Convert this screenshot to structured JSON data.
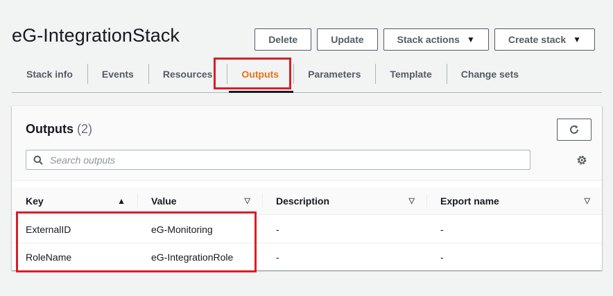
{
  "stack": {
    "name": "eG-IntegrationStack"
  },
  "actions": {
    "delete_label": "Delete",
    "update_label": "Update",
    "stack_actions_label": "Stack actions",
    "create_stack_label": "Create stack"
  },
  "tabs": [
    {
      "label": "Stack info"
    },
    {
      "label": "Events"
    },
    {
      "label": "Resources"
    },
    {
      "label": "Outputs",
      "active": true
    },
    {
      "label": "Parameters"
    },
    {
      "label": "Template"
    },
    {
      "label": "Change sets"
    }
  ],
  "outputs": {
    "title": "Outputs",
    "count": "(2)",
    "search_placeholder": "Search outputs",
    "columns": [
      "Key",
      "Value",
      "Description",
      "Export name"
    ],
    "rows": [
      {
        "key": "ExternalID",
        "value": "eG-Monitoring",
        "description": "-",
        "export_name": "-"
      },
      {
        "key": "RoleName",
        "value": "eG-IntegrationRole",
        "description": "-",
        "export_name": "-"
      }
    ]
  },
  "icons": {
    "refresh": "refresh-icon",
    "search": "search-icon",
    "settings": "gear-icon",
    "caret": "caret-down-icon"
  },
  "colors": {
    "active_tab": "#ec7211",
    "highlight": "#d91e26",
    "text": "#16191f"
  }
}
